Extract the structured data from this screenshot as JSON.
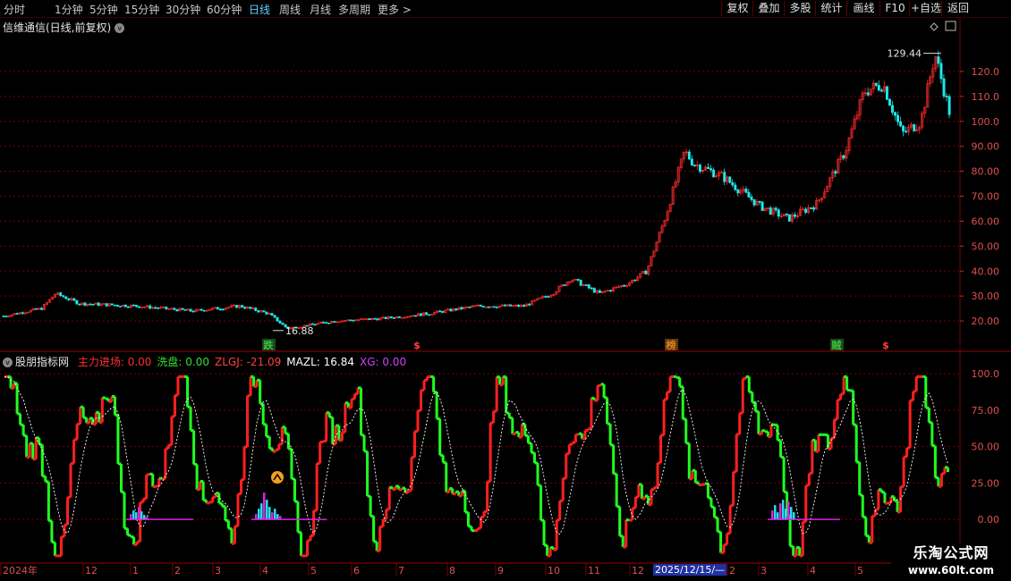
{
  "toolbar": {
    "tabs": [
      "分时",
      "1分钟",
      "5分钟",
      "15分钟",
      "30分钟",
      "60分钟",
      "日线",
      "周线",
      "月线",
      "多周期",
      "更多 >"
    ],
    "active_tab": "日线",
    "right_buttons": [
      "复权",
      "叠加",
      "多股",
      "统计",
      "画线",
      "F10",
      "+自选",
      "返回"
    ]
  },
  "main_panel": {
    "title": "信维通信(日线,前复权)",
    "high_label": "129.44",
    "low_label": "16.88",
    "y_ticks": [
      "120.0",
      "110.0",
      "100.0",
      "90.00",
      "80.00",
      "70.00",
      "60.00",
      "50.00",
      "40.00",
      "30.00",
      "20.00"
    ],
    "signals": [
      {
        "text": "跌",
        "color": "#40c040"
      },
      {
        "text": "$",
        "color": "#ff4040"
      },
      {
        "text": "榜",
        "color": "#e08020"
      },
      {
        "text": "贼",
        "color": "#40c040"
      },
      {
        "text": "$",
        "color": "#ff4040"
      }
    ]
  },
  "indicator_panel": {
    "name": "股朋指标网",
    "values": [
      {
        "label": "主力进场: 0.00",
        "color": "#ff3030"
      },
      {
        "label": "洗盘: 0.00",
        "color": "#30e030"
      },
      {
        "label": "ZLGJ: -21.09",
        "color": "#ff4040"
      },
      {
        "label": "MAZL: 16.84",
        "color": "#ffffff"
      },
      {
        "label": "XG: 0.00",
        "color": "#d040ff"
      }
    ],
    "y_ticks": [
      "100.0",
      "75.00",
      "50.00",
      "25.00",
      "0.00"
    ]
  },
  "date_axis": {
    "labels": [
      "2024年",
      "12",
      "1",
      "2",
      "3",
      "4",
      "5",
      "6",
      "7",
      "8",
      "9",
      "10",
      "11",
      "12",
      "2",
      "3",
      "4",
      "5"
    ],
    "cursor_date": "2025/12/15/—"
  },
  "watermark": {
    "line1": "乐淘公式网",
    "line2": "www.60lt.com"
  },
  "colors": {
    "up": "#ff2a2a",
    "down": "#20e8e8",
    "ind_up": "#ff2020",
    "ind_down": "#20ff20",
    "grid": "#7a0000"
  },
  "chart_data": {
    "type": "candlestick",
    "price_range": [
      10,
      130
    ],
    "high_point": 129.44,
    "low_point": 16.88,
    "price_waypoints": [
      {
        "t": 0.0,
        "v": 22
      },
      {
        "t": 0.04,
        "v": 25
      },
      {
        "t": 0.055,
        "v": 31
      },
      {
        "t": 0.08,
        "v": 27
      },
      {
        "t": 0.14,
        "v": 26
      },
      {
        "t": 0.2,
        "v": 24
      },
      {
        "t": 0.25,
        "v": 26
      },
      {
        "t": 0.28,
        "v": 23
      },
      {
        "t": 0.3,
        "v": 17
      },
      {
        "t": 0.35,
        "v": 20
      },
      {
        "t": 0.4,
        "v": 21
      },
      {
        "t": 0.45,
        "v": 23
      },
      {
        "t": 0.5,
        "v": 26
      },
      {
        "t": 0.55,
        "v": 26
      },
      {
        "t": 0.58,
        "v": 31
      },
      {
        "t": 0.6,
        "v": 37
      },
      {
        "t": 0.63,
        "v": 31
      },
      {
        "t": 0.66,
        "v": 35
      },
      {
        "t": 0.68,
        "v": 40
      },
      {
        "t": 0.7,
        "v": 62
      },
      {
        "t": 0.72,
        "v": 88
      },
      {
        "t": 0.73,
        "v": 83
      },
      {
        "t": 0.76,
        "v": 78
      },
      {
        "t": 0.8,
        "v": 66
      },
      {
        "t": 0.83,
        "v": 61
      },
      {
        "t": 0.86,
        "v": 67
      },
      {
        "t": 0.89,
        "v": 88
      },
      {
        "t": 0.91,
        "v": 112
      },
      {
        "t": 0.93,
        "v": 115
      },
      {
        "t": 0.95,
        "v": 95
      },
      {
        "t": 0.97,
        "v": 100
      },
      {
        "t": 0.985,
        "v": 127
      },
      {
        "t": 1.0,
        "v": 104
      }
    ],
    "indicator_range": [
      -30,
      105
    ]
  }
}
